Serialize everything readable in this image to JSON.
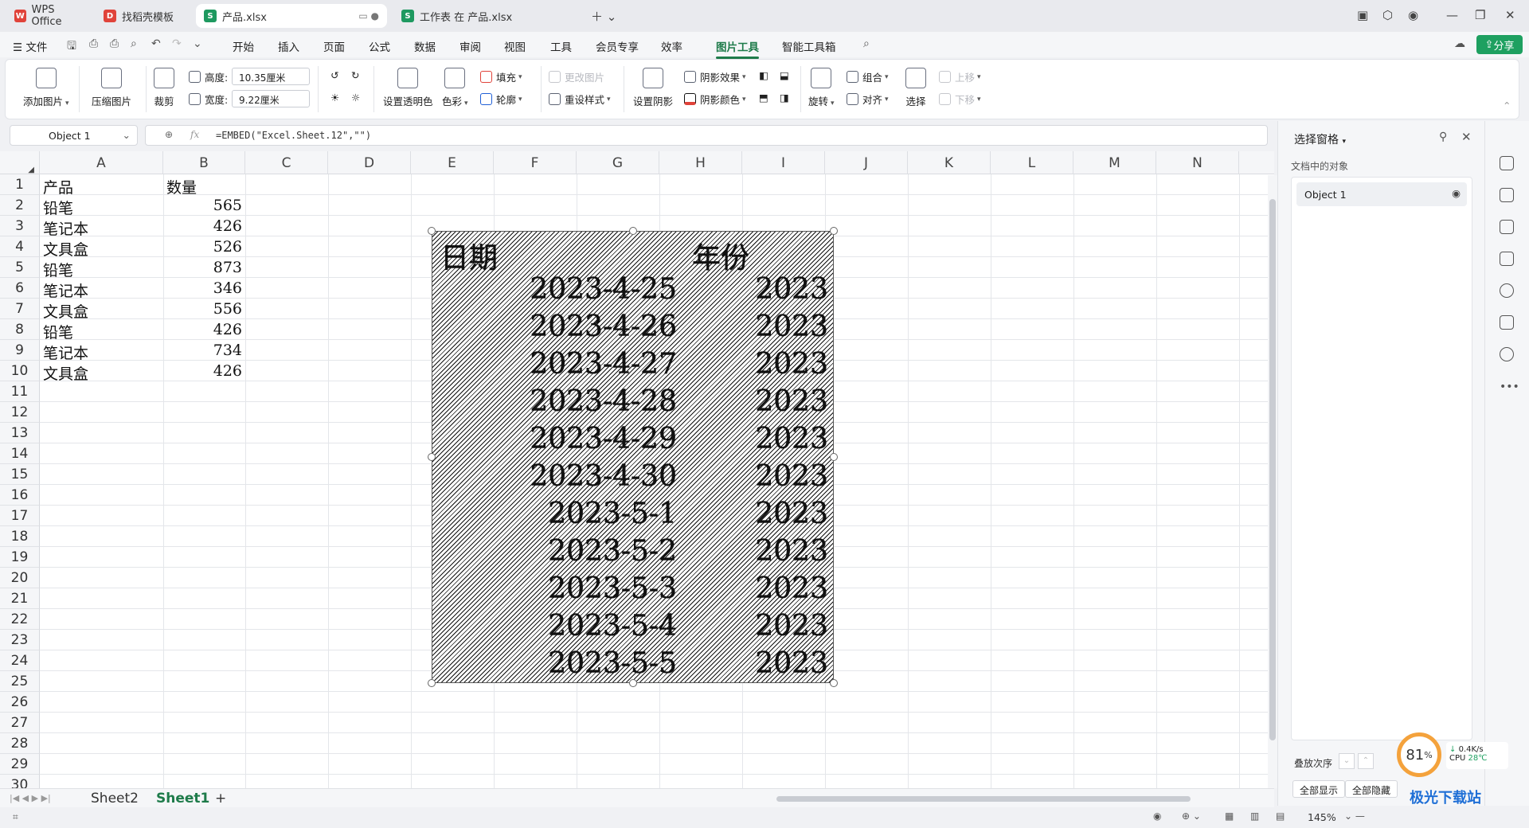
{
  "tabs": [
    {
      "label": "WPS Office",
      "icon": "wps-icon",
      "color": "#e0433a"
    },
    {
      "label": "找稻壳模板",
      "icon": "docer-icon",
      "color": "#e0433a"
    },
    {
      "label": "产品.xlsx",
      "icon": "sheet-icon",
      "color": "#1e9960"
    },
    {
      "label": "工作表 在 产品.xlsx",
      "icon": "sheet-icon",
      "color": "#1e9960"
    }
  ],
  "menu": {
    "file": "文件",
    "items": [
      "开始",
      "插入",
      "页面",
      "公式",
      "数据",
      "审阅",
      "视图",
      "工具",
      "会员专享",
      "效率",
      "图片工具",
      "智能工具箱"
    ],
    "active": "图片工具",
    "share": "分享"
  },
  "ribbon": {
    "add_picture": "添加图片",
    "compress": "压缩图片",
    "crop": "裁剪",
    "height_label": "高度:",
    "height_value": "10.35厘米",
    "width_label": "宽度:",
    "width_value": "9.22厘米",
    "transparent": "设置透明色",
    "color": "色彩",
    "fill": "填充",
    "outline": "轮廓",
    "change_picture": "更改图片",
    "reset_style": "重设样式",
    "set_shadow": "设置阴影",
    "shadow_effect": "阴影效果",
    "shadow_color": "阴影颜色",
    "rotate": "旋转",
    "group": "组合",
    "align": "对齐",
    "select": "选择",
    "bring_forward": "上移",
    "send_backward": "下移"
  },
  "formula_bar": {
    "name_box": "Object 1",
    "fx": "fx",
    "formula": "=EMBED(\"Excel.Sheet.12\",\"\")"
  },
  "columns": [
    "A",
    "B",
    "C",
    "D",
    "E",
    "F",
    "G",
    "H",
    "I",
    "J",
    "K",
    "L",
    "M",
    "N"
  ],
  "rows": [
    "1",
    "2",
    "3",
    "4",
    "5",
    "6",
    "7",
    "8",
    "9",
    "10",
    "11",
    "12",
    "13",
    "14",
    "15",
    "16",
    "17",
    "18",
    "19",
    "20",
    "21",
    "22",
    "23",
    "24",
    "25",
    "26",
    "27",
    "28",
    "29",
    "30"
  ],
  "cells": {
    "header": [
      "产品",
      "数量"
    ],
    "data": [
      [
        "铅笔",
        "565"
      ],
      [
        "笔记本",
        "426"
      ],
      [
        "文具盒",
        "526"
      ],
      [
        "铅笔",
        "873"
      ],
      [
        "笔记本",
        "346"
      ],
      [
        "文具盒",
        "556"
      ],
      [
        "铅笔",
        "426"
      ],
      [
        "笔记本",
        "734"
      ],
      [
        "文具盒",
        "426"
      ]
    ]
  },
  "embedded_object": {
    "header": [
      "日期",
      "年份"
    ],
    "rows": [
      [
        "2023-4-25",
        "2023"
      ],
      [
        "2023-4-26",
        "2023"
      ],
      [
        "2023-4-27",
        "2023"
      ],
      [
        "2023-4-28",
        "2023"
      ],
      [
        "2023-4-29",
        "2023"
      ],
      [
        "2023-4-30",
        "2023"
      ],
      [
        "2023-5-1",
        "2023"
      ],
      [
        "2023-5-2",
        "2023"
      ],
      [
        "2023-5-3",
        "2023"
      ],
      [
        "2023-5-4",
        "2023"
      ],
      [
        "2023-5-5",
        "2023"
      ]
    ]
  },
  "sheets": [
    "Sheet2",
    "Sheet1"
  ],
  "active_sheet": "Sheet1",
  "add_sheet": "+",
  "zoom": "145%",
  "panel": {
    "title": "选择窗格",
    "subtitle": "文档中的对象",
    "object": "Object 1",
    "layer_order": "叠放次序",
    "show_all": "全部显示",
    "hide_all": "全部隐藏"
  },
  "perf": {
    "percent": "81",
    "unit": "%",
    "net": "0.4K/s",
    "cpu": "CPU",
    "temp": "28℃"
  },
  "watermark": "极光下载站"
}
